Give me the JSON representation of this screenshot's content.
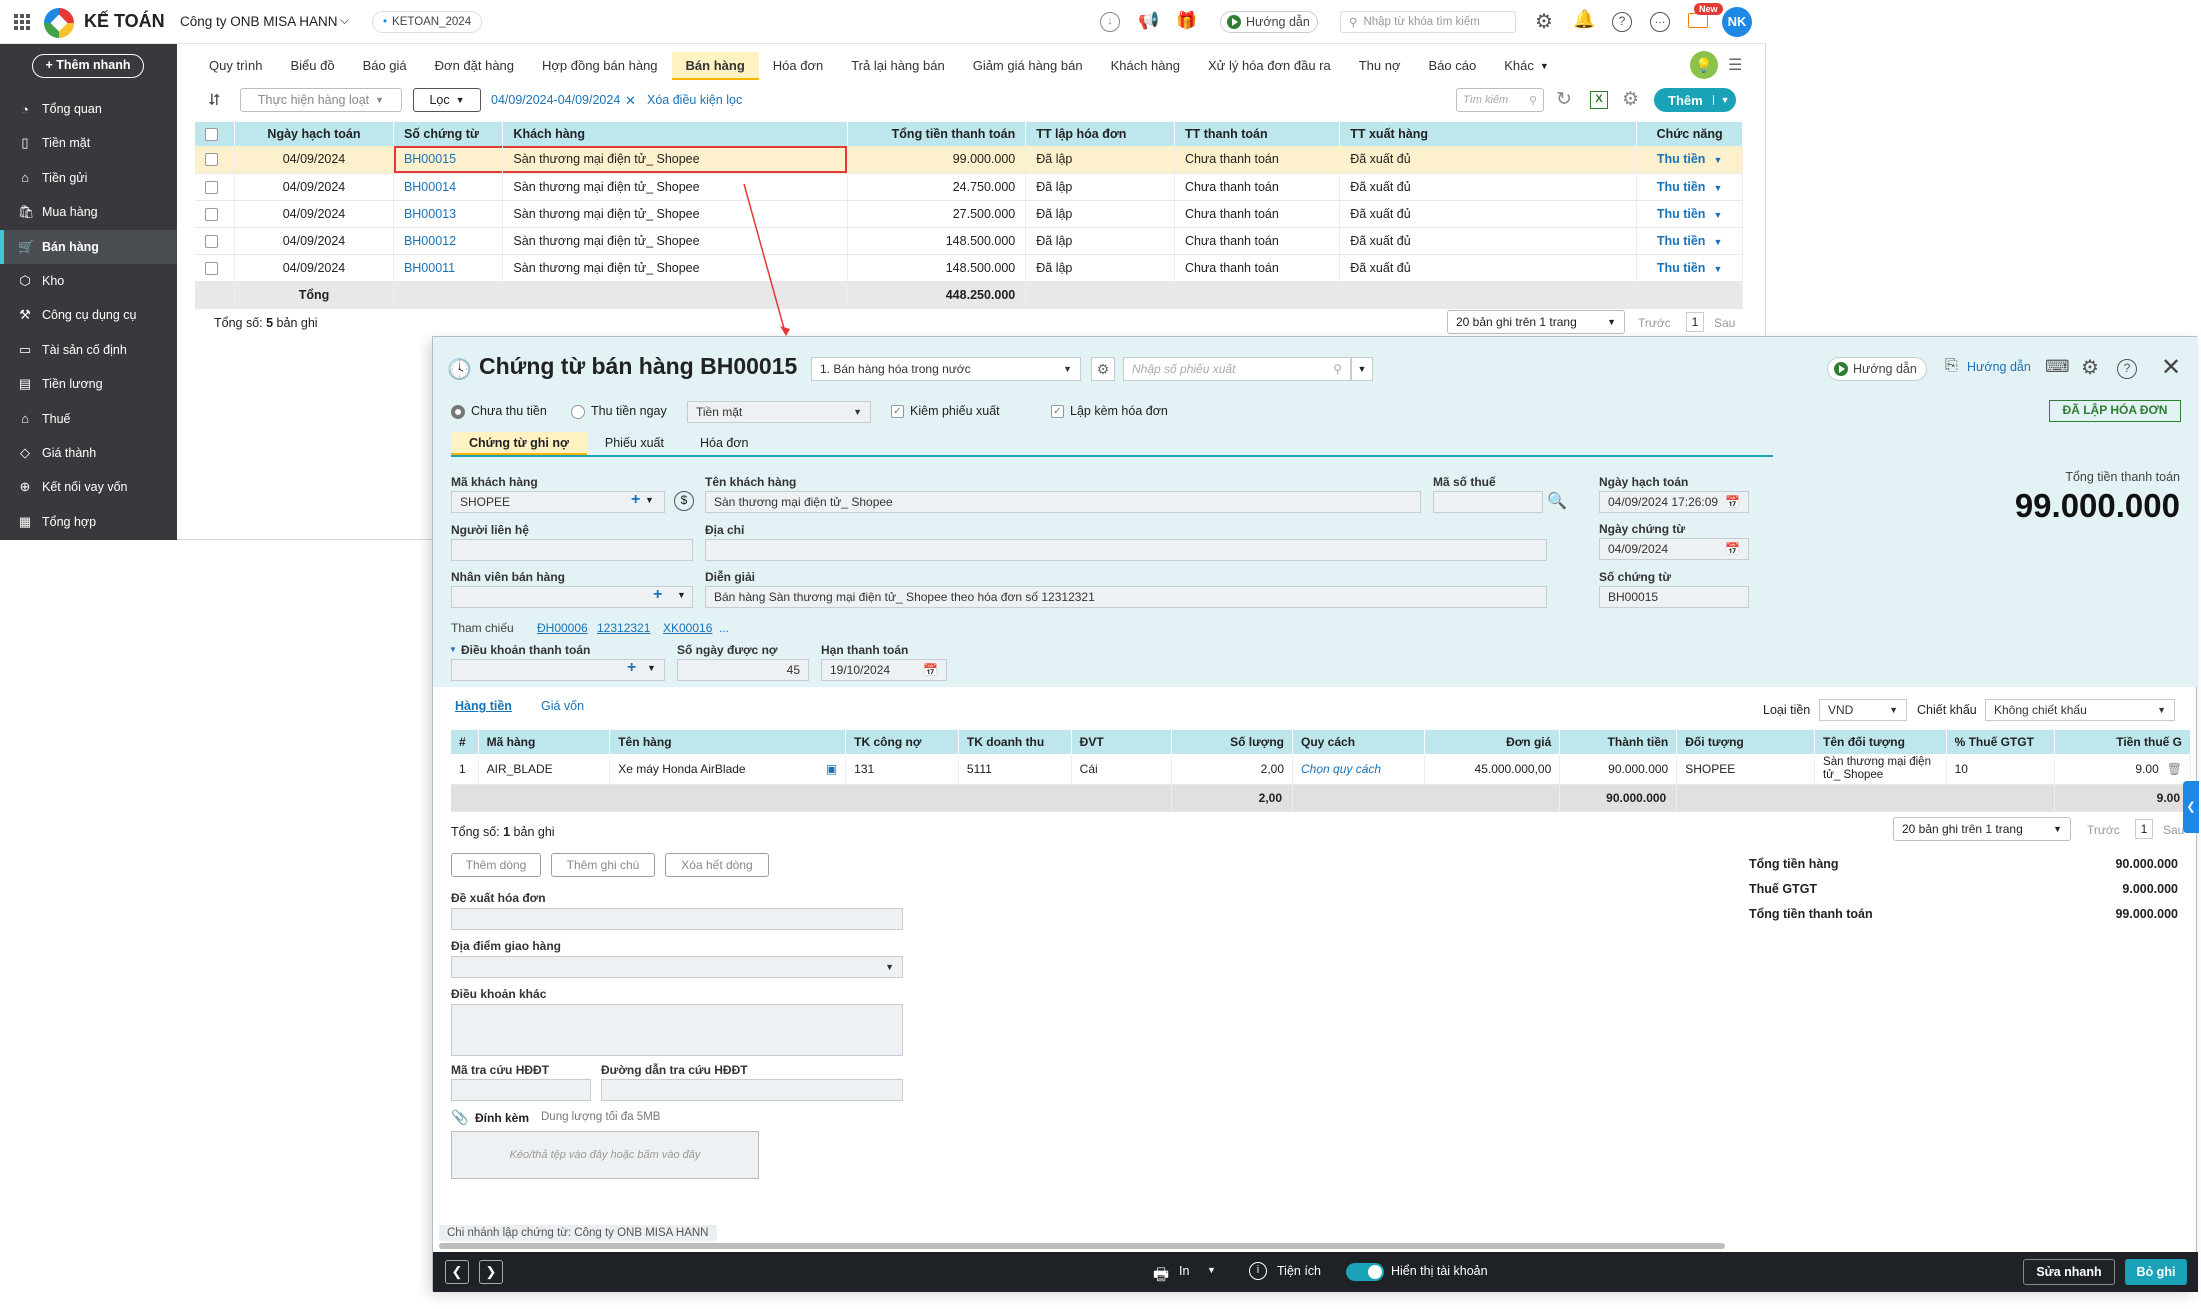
{
  "app": {
    "brand": "KẾ TOÁN",
    "company": "Công ty ONB MISA HANN",
    "db": "KETOAN_2024",
    "help": "Hướng dẫn",
    "search_placeholder": "Nhập từ khóa tìm kiếm",
    "new_badge": "New",
    "avatar": "NK"
  },
  "sidebar": {
    "quick_add": "+ Thêm nhanh",
    "items": [
      "Tổng quan",
      "Tiền mặt",
      "Tiền gửi",
      "Mua hàng",
      "Bán hàng",
      "Kho",
      "Công cụ dụng cụ",
      "Tài sản cố định",
      "Tiền lương",
      "Thuế",
      "Giá thành",
      "Kết nối vay vốn",
      "Tổng hợp"
    ],
    "active": "Bán hàng"
  },
  "tabs": [
    "Quy trình",
    "Biểu đồ",
    "Báo giá",
    "Đơn đặt hàng",
    "Hợp đồng bán hàng",
    "Bán hàng",
    "Hóa đơn",
    "Trả lại hàng bán",
    "Giảm giá hàng bán",
    "Khách hàng",
    "Xử lý hóa đơn đầu ra",
    "Thu nợ",
    "Báo cáo",
    "Khác"
  ],
  "toolbar": {
    "bulk": "Thực hiện hàng loạt",
    "filter": "Lọc",
    "date_range": "04/09/2024-04/09/2024",
    "clear": "Xóa điều kiện lọc",
    "search": "Tìm kiếm",
    "add": "Thêm"
  },
  "list": {
    "headers": [
      "Ngày hạch toán",
      "Số chứng từ",
      "Khách hàng",
      "Tổng tiền thanh toán",
      "TT lập hóa đơn",
      "TT thanh toán",
      "TT xuất hàng",
      "Chức năng"
    ],
    "rows": [
      [
        "04/09/2024",
        "BH00015",
        "Sàn thương mại điện tử_ Shopee",
        "99.000.000",
        "Đã lập",
        "Chưa thanh toán",
        "Đã xuất đủ",
        "Thu tiền"
      ],
      [
        "04/09/2024",
        "BH00014",
        "Sàn thương mại điện tử_ Shopee",
        "24.750.000",
        "Đã lập",
        "Chưa thanh toán",
        "Đã xuất đủ",
        "Thu tiền"
      ],
      [
        "04/09/2024",
        "BH00013",
        "Sàn thương mại điện tử_ Shopee",
        "27.500.000",
        "Đã lập",
        "Chưa thanh toán",
        "Đã xuất đủ",
        "Thu tiền"
      ],
      [
        "04/09/2024",
        "BH00012",
        "Sàn thương mại điện tử_ Shopee",
        "148.500.000",
        "Đã lập",
        "Chưa thanh toán",
        "Đã xuất đủ",
        "Thu tiền"
      ],
      [
        "04/09/2024",
        "BH00011",
        "Sàn thương mại điện tử_ Shopee",
        "148.500.000",
        "Đã lập",
        "Chưa thanh toán",
        "Đã xuất đủ",
        "Thu tiền"
      ]
    ],
    "total_label": "Tổng",
    "total": "448.250.000",
    "count_prefix": "Tổng số: ",
    "count": "5",
    "count_suffix": " bản ghi",
    "paging": "20 bản ghi trên 1 trang",
    "prev": "Trước",
    "page": "1",
    "next": "Sau"
  },
  "detail": {
    "title": "Chứng từ bán hàng BH00015",
    "type": "1. Bán hàng hóa trong nước",
    "export_placeholder": "Nhập số phiếu xuất",
    "help": "Hướng dẫn",
    "help2": "Hướng dẫn",
    "status": "ĐÃ LẬP HÓA ĐƠN",
    "pay_options": [
      "Chưa thu tiền",
      "Thu tiền ngay"
    ],
    "pay_method": "Tiền mặt",
    "chk1": "Kiêm phiếu xuất",
    "chk2": "Lập kèm hóa đơn",
    "subtabs": [
      "Chứng từ ghi nợ",
      "Phiếu xuất",
      "Hóa đơn"
    ],
    "customer_code_label": "Mã khách hàng",
    "customer_code": "SHOPEE",
    "customer_name_label": "Tên khách hàng",
    "customer_name": "Sàn thương mại điện tử_ Shopee",
    "tax_label": "Mã số thuế",
    "contact_label": "Người liên hệ",
    "address_label": "Địa chỉ",
    "staff_label": "Nhân viên bán hàng",
    "desc_label": "Diễn giải",
    "desc": "Bán hàng Sàn thương mại điện tử_ Shopee theo hóa đơn số 12312321",
    "ref_label": "Tham chiếu",
    "refs": [
      "ĐH00006",
      "12312321",
      "XK00016",
      "..."
    ],
    "terms_label": "Điều khoản thanh toán",
    "days_label": "Số ngày được nợ",
    "days": "45",
    "due_label": "Hạn thanh toán",
    "due": "19/10/2024",
    "post_date_label": "Ngày hạch toán",
    "post_date": "04/09/2024 17:26:09",
    "doc_date_label": "Ngày chứng từ",
    "doc_date": "04/09/2024",
    "doc_no_label": "Số chứng từ",
    "doc_no": "BH00015",
    "total_label": "Tổng tiền thanh toán",
    "total": "99.000.000",
    "line_tabs": [
      "Hàng tiền",
      "Giá vốn"
    ],
    "currency_label": "Loại tiền",
    "currency": "VND",
    "discount_label": "Chiết khấu",
    "discount": "Không chiết khấu",
    "line_headers": [
      "#",
      "Mã hàng",
      "Tên hàng",
      "TK công nợ",
      "TK doanh thu",
      "ĐVT",
      "Số lượng",
      "Quy cách",
      "Đơn giá",
      "Thành tiền",
      "Đối tượng",
      "Tên đối tượng",
      "% Thuế GTGT",
      "Tiền thuế G"
    ],
    "line": [
      "1",
      "AIR_BLADE",
      "Xe máy Honda AirBlade",
      "131",
      "5111",
      "Cái",
      "2,00",
      "Chọn quy cách",
      "45.000.000,00",
      "90.000.000",
      "SHOPEE",
      "Sàn thương mại điện tử_ Shopee",
      "10",
      "9.00"
    ],
    "sum_qty": "2,00",
    "sum_amount": "90.000.000",
    "sum_tax": "9.00",
    "line_count_prefix": "Tổng số: ",
    "line_count": "1",
    "line_count_suffix": " bản ghi",
    "paging": "20 bản ghi trên 1 trang",
    "prev": "Trước",
    "page": "1",
    "next": "Sau",
    "btn_add_row": "Thêm dòng",
    "btn_add_note": "Thêm ghi chú",
    "btn_delete": "Xóa hết dòng",
    "sum_goods_label": "Tổng tiền hàng",
    "sum_goods": "90.000.000",
    "sum_vat_label": "Thuế GTGT",
    "sum_vat": "9.000.000",
    "sum_total_label": "Tổng tiền thanh toán",
    "sum_total": "99.000.000",
    "invoice_req_label": "Đề xuất hóa đơn",
    "delivery_label": "Địa điểm giao hàng",
    "other_terms_label": "Điều khoản khác",
    "lookup_code_label": "Mã tra cứu HĐĐT",
    "lookup_url_label": "Đường dẫn tra cứu HĐĐT",
    "attach_label": "Đính kèm",
    "attach_note": "Dung lượng tối đa 5MB",
    "drop_text": "Kéo/thả tệp vào đây hoặc bấm vào đây",
    "branch": "Chi nhánh lập chứng từ: Công ty ONB MISA HANN",
    "footer": {
      "print": "In",
      "utilities": "Tiện ích",
      "show_accounts": "Hiển thị tài khoản",
      "quick_edit": "Sửa nhanh",
      "unpost": "Bỏ ghi"
    }
  }
}
